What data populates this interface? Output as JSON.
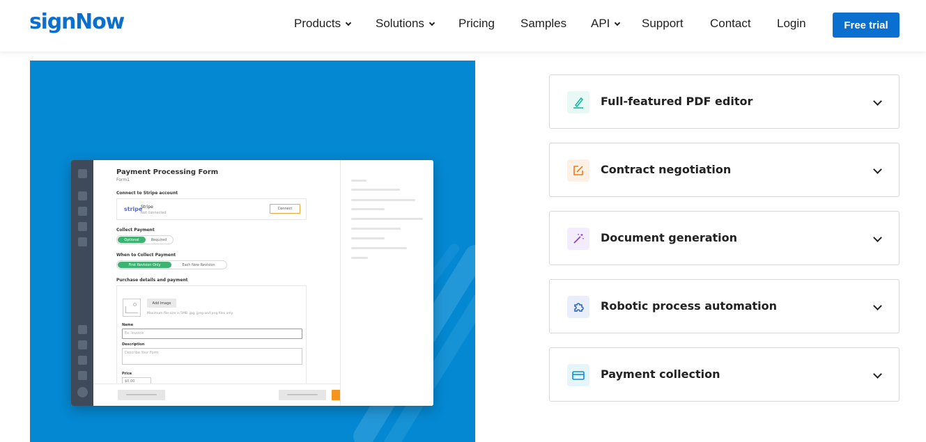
{
  "header": {
    "logo": "signNow",
    "nav": [
      {
        "label": "Products",
        "dropdown": true
      },
      {
        "label": "Solutions",
        "dropdown": true
      },
      {
        "label": "Pricing",
        "dropdown": false
      },
      {
        "label": "Samples",
        "dropdown": false
      },
      {
        "label": "API",
        "dropdown": true
      },
      {
        "label": "Support",
        "dropdown": false
      },
      {
        "label": "Contact",
        "dropdown": false
      },
      {
        "label": "Login",
        "dropdown": false
      }
    ],
    "cta": "Free trial"
  },
  "colors": {
    "brand": "#0b6fd0",
    "hero_bg": "#0488d1",
    "toggle_on": "#3cb371",
    "primary_action": "#f7941d"
  },
  "mock_form": {
    "title": "Payment Processing Form",
    "subtitle": "Form1",
    "connect_label": "Connect to Stripe account",
    "stripe_logo": "stripe",
    "stripe_name": "Stripe",
    "stripe_status": "Not connected",
    "connect_button": "Connect",
    "collect_label": "Collect Payment",
    "collect_options": [
      "Optional",
      "Required"
    ],
    "when_label": "When to Collect Payment",
    "when_options": [
      "First Revision Only",
      "Each New Revision"
    ],
    "purchase_label": "Purchase details and payment",
    "add_image": "Add Image",
    "image_hint": "Maximum file size is 5MB. jpg, jpeg and png files only.",
    "name_label": "Name",
    "name_placeholder": "Ex. Invoice",
    "description_label": "Description",
    "description_placeholder": "Describe Your Form",
    "price_label": "Price",
    "price_value": "$0.00"
  },
  "features": [
    {
      "title": "Full-featured PDF editor",
      "icon": "pen-icon",
      "color": "#19b99a",
      "bg": "#e8f8f4"
    },
    {
      "title": "Contract negotiation",
      "icon": "edit-square-icon",
      "color": "#f07c1b",
      "bg": "#fdf1e6"
    },
    {
      "title": "Document generation",
      "icon": "magic-wand-icon",
      "color": "#8a3ee0",
      "bg": "#f3ecfc"
    },
    {
      "title": "Robotic process automation",
      "icon": "puzzle-icon",
      "color": "#2a5fb8",
      "bg": "#e8eefa"
    },
    {
      "title": "Payment collection",
      "icon": "credit-card-icon",
      "color": "#0b8fd6",
      "bg": "#e6f4fc"
    }
  ]
}
